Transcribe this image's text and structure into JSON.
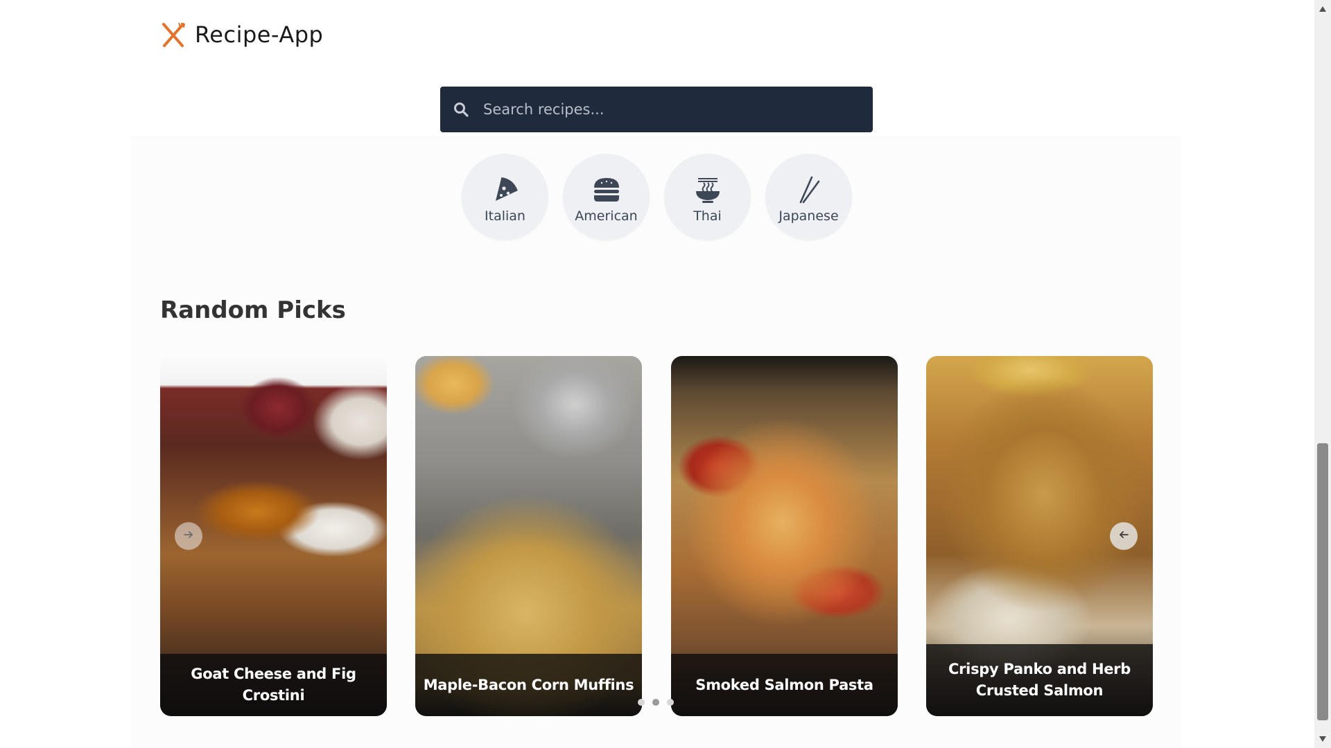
{
  "header": {
    "logo_icon": "fork-knife-icon",
    "brand_name": "Recipe-App",
    "accent_color": "#e4722a"
  },
  "search": {
    "icon": "search-icon",
    "placeholder": "Search recipes...",
    "value": "",
    "background_color": "#1f2a3c"
  },
  "cuisines": [
    {
      "label": "Italian",
      "icon": "pizza-slice-icon"
    },
    {
      "label": "American",
      "icon": "hamburger-icon"
    },
    {
      "label": "Thai",
      "icon": "noodle-bowl-icon"
    },
    {
      "label": "Japanese",
      "icon": "chopsticks-icon"
    }
  ],
  "random_picks": {
    "title": "Random Picks",
    "cards": [
      {
        "title": "Goat Cheese and Fig Crostini"
      },
      {
        "title": "Maple-Bacon Corn Muffins"
      },
      {
        "title": "Smoked Salmon Pasta"
      },
      {
        "title": "Crispy Panko and Herb Crusted Salmon"
      }
    ],
    "prev_icon": "arrow-right-icon",
    "next_icon": "arrow-left-icon",
    "dot_count": 3,
    "active_dot": 1
  },
  "scrollbar": {
    "position_fraction": 0.72
  }
}
